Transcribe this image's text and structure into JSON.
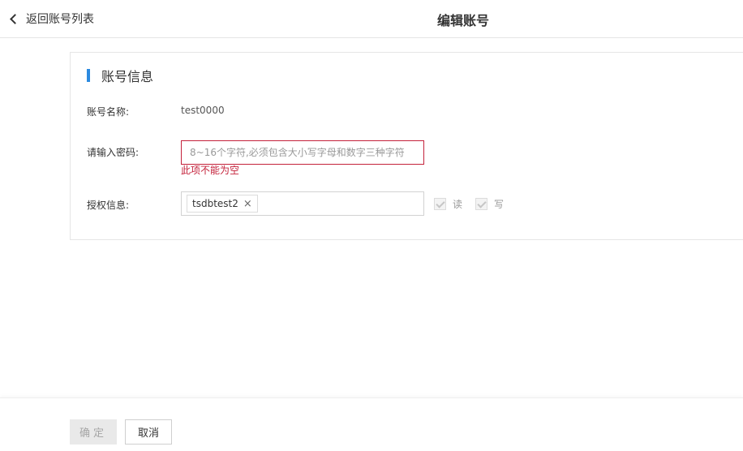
{
  "header": {
    "back_label": "返回账号列表",
    "title": "编辑账号"
  },
  "section": {
    "title": "账号信息"
  },
  "form": {
    "account_name_label": "账号名称:",
    "account_name_value": "test0000",
    "password_label": "请输入密码:",
    "password_placeholder": "8~16个字符,必须包含大小写字母和数字三种字符",
    "password_value": "",
    "password_error": "此项不能为空",
    "auth_label": "授权信息:",
    "auth_tags": [
      "tsdbtest2"
    ],
    "tag_remove_glyph": "×",
    "perm_read_label": "读",
    "perm_write_label": "写"
  },
  "footer": {
    "confirm_label": "确定",
    "cancel_label": "取消"
  },
  "colors": {
    "accent": "#2b8ae0",
    "error": "#c4223b"
  }
}
